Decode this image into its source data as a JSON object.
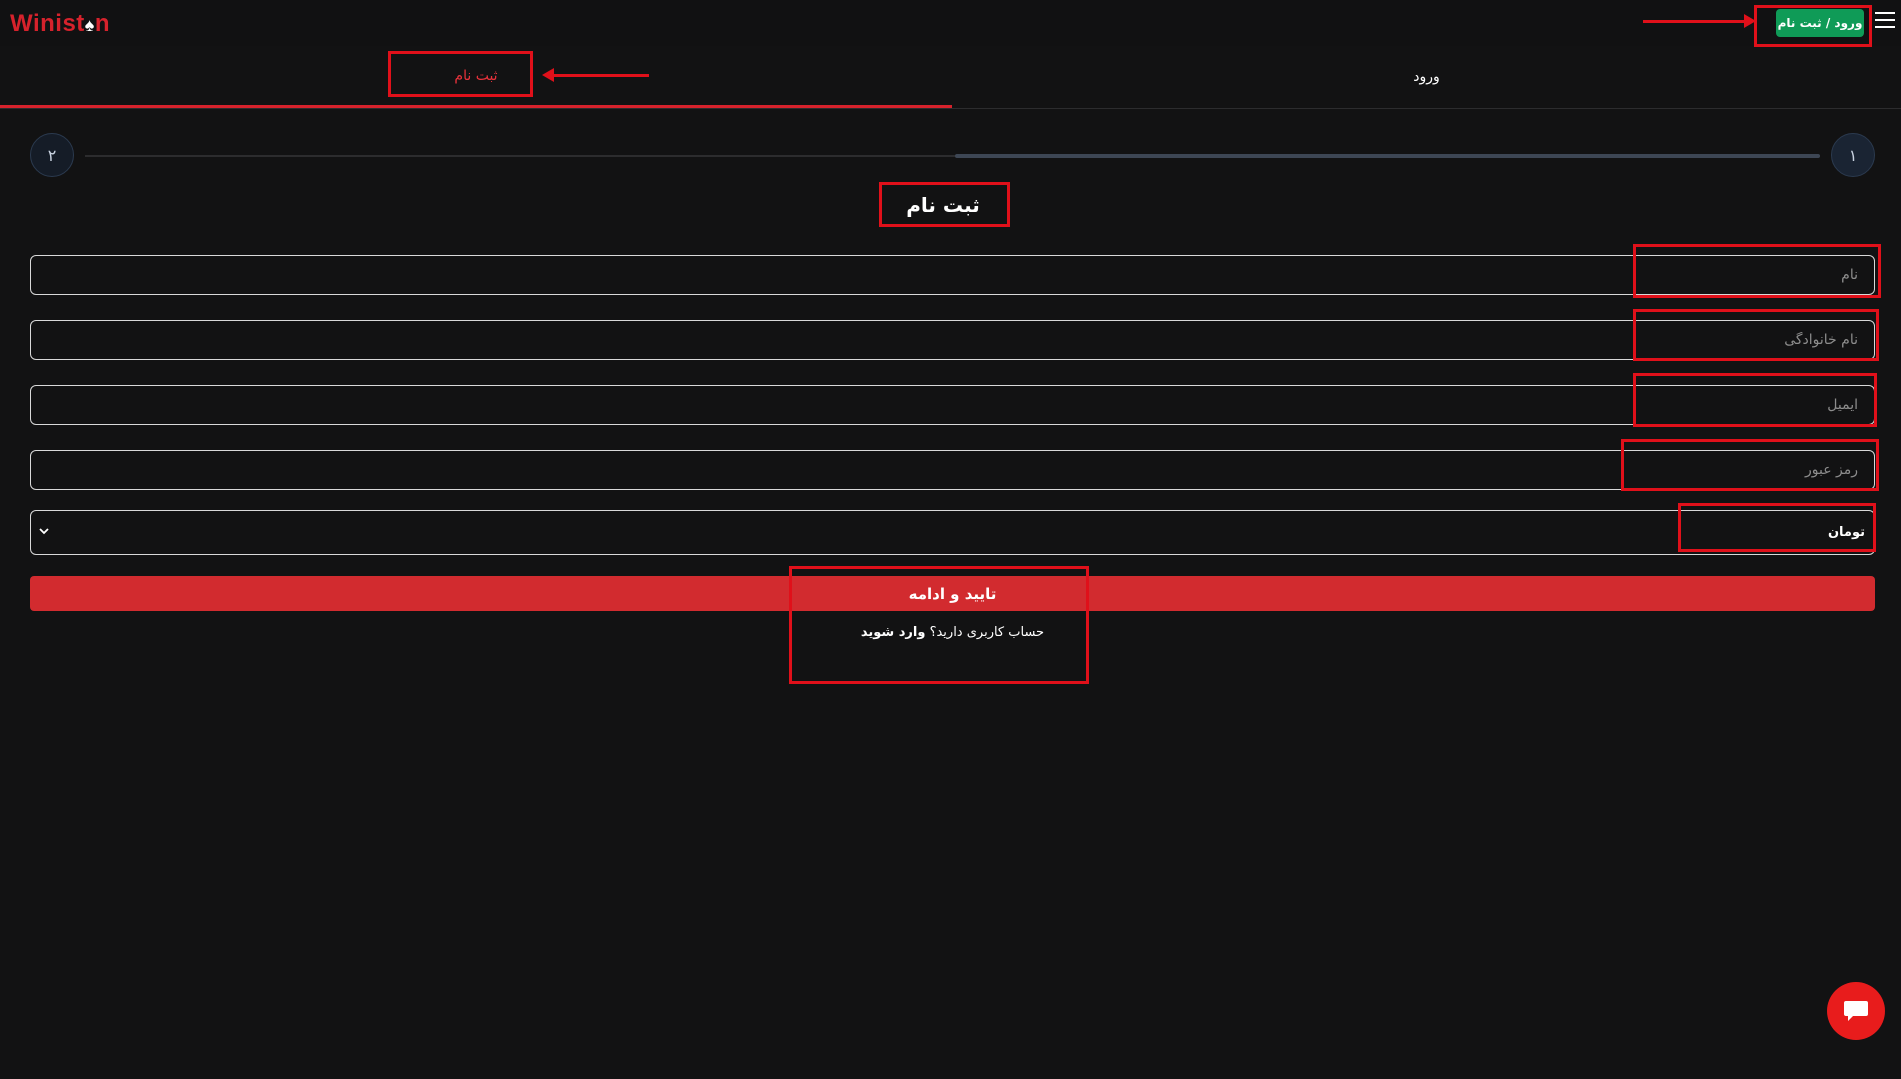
{
  "header": {
    "logo_text": "Winist",
    "logo_tail": "n",
    "logo_spade": "♠",
    "auth_button": "ورود / ثبت نام",
    "menu_icon": "hamburger-menu-icon"
  },
  "tabs": {
    "signup": "ثبت نام",
    "login": "ورود"
  },
  "stepper": {
    "step_one": "۱",
    "step_two": "۲"
  },
  "form": {
    "title": "ثبت نام",
    "first_name_placeholder": "نام",
    "last_name_placeholder": "نام خانوادگی",
    "email_placeholder": "ایمیل",
    "password_placeholder": "رمز عبور",
    "currency_selected": "تومان",
    "submit_label": "تایید و ادامه",
    "have_account_text": "حساب کاربری دارید؟",
    "login_link": "وارد شوید"
  },
  "chat": {
    "icon": "chat-bubble-icon"
  },
  "colors": {
    "background": "#121213",
    "accent_red": "#d22b2f",
    "auth_green": "#0f9b57",
    "annotation_red": "#e0101a"
  }
}
